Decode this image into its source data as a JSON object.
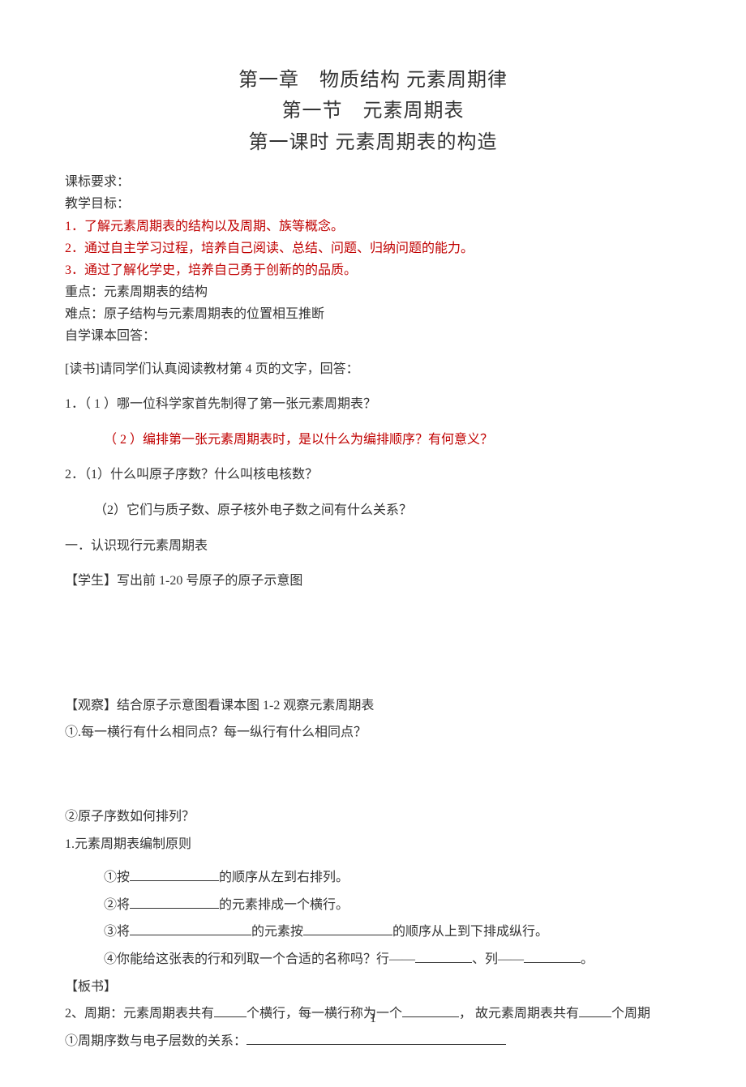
{
  "title": {
    "chapter": "第一章　物质结构 元素周期律",
    "section": "第一节　元素周期表",
    "lesson": "第一课时  元素周期表的构造"
  },
  "header": {
    "requirement_label": "课标要求：",
    "objectives_label": "教学目标：",
    "obj1": "1．了解元素周期表的结构以及周期、族等概念。",
    "obj2": "2．通过自主学习过程，培养自己阅读、总结、问题、归纳问题的能力。",
    "obj3": "3．通过了解化学史，培养自己勇于创新的的品质。",
    "key_point": "重点：元素周期表的结构",
    "difficulty": "难点：原子结构与元素周期表的位置相互推断",
    "self_study": "自学课本回答："
  },
  "reading": {
    "instruction": "[读书]请同学们认真阅读教材第 4 页的文字，回答：",
    "q1a": "1．（ 1 ）哪一位科学家首先制得了第一张元素周期表？",
    "q1b": "（ 2 ）编排第一张元素周期表时，是以什么为编排顺序？有何意义？",
    "q2a": "2．（1）什么叫原子序数？什么叫核电核数？",
    "q2b": "（2）它们与质子数、原子核外电子数之间有什么关系？"
  },
  "section1": {
    "heading": "一．认识现行元素周期表",
    "student": "【学生】写出前 1-20 号原子的原子示意图",
    "observe": "【观察】结合原子示意图看课本图 1-2 观察元素周期表",
    "q1": "①.每一横行有什么相同点？每一纵行有什么相同点？",
    "q2": "②原子序数如何排列？",
    "principle_heading": "1.元素周期表编制原则",
    "p1_pre": "①按",
    "p1_post": "的顺序从左到右排列。",
    "p2_pre": "②将",
    "p2_post": "的元素排成一个横行。",
    "p3_pre": "③将",
    "p3_mid": "的元素按",
    "p3_post": "的顺序从上到下排成纵行。",
    "p4_pre": "④你能给这张表的行和列取一个合适的名称吗？行——",
    "p4_mid": "、列——",
    "p4_post": "。",
    "board": "【板书】",
    "period_pre": "2、周期：元素周期表共有",
    "period_mid1": "个横行，每一横行称为一个",
    "period_mid2": "， 故元素周期表共有",
    "period_post": "个周期",
    "relation_pre": "①周期序数与电子层数的关系："
  },
  "footer": {
    "page": "1"
  }
}
